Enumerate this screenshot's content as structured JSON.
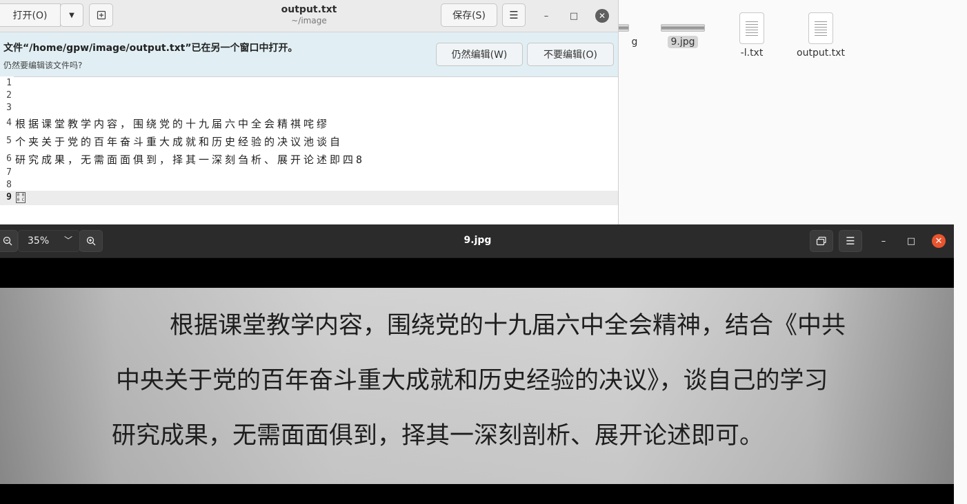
{
  "files": {
    "items": [
      {
        "name": "g",
        "type": "image"
      },
      {
        "name": "9.jpg",
        "type": "image",
        "selected": true
      },
      {
        "name": "-l.txt",
        "type": "text"
      },
      {
        "name": "output.txt",
        "type": "text"
      }
    ]
  },
  "gedit": {
    "open_label": "打开(O)",
    "title": "output.txt",
    "subtitle": "~/image",
    "save_label": "保存(S)",
    "infobar": {
      "title": "文件“/home/gpw/image/output.txt”已在另一个窗口中打开。",
      "subtitle": "仍然要编辑该文件吗?",
      "edit_anyway": "仍然编辑(W)",
      "dont_edit": "不要编辑(O)"
    },
    "lines": [
      {
        "num": "1",
        "text": ""
      },
      {
        "num": "2",
        "text": ""
      },
      {
        "num": "3",
        "text": ""
      },
      {
        "num": "4",
        "text": "根据课堂教学内容，围绕党的十九届六中全会精祺咤缪"
      },
      {
        "num": "5",
        "text": "个夹关于党的百年奋斗重大成就和历史经验的决议池谈自"
      },
      {
        "num": "6",
        "text": "研究成果，无需面面俱到，择其一深刻刍析、展开论述即四8"
      },
      {
        "num": "7",
        "text": ""
      },
      {
        "num": "8",
        "text": ""
      },
      {
        "num": "9",
        "text": "",
        "glyph": "0 0 0 C",
        "current": true
      }
    ]
  },
  "viewer": {
    "zoom": "35%",
    "title": "9.jpg",
    "photo_lines": [
      "根据课堂教学内容，围绕党的十九届六中全会精神，结合《中共",
      "中央关于党的百年奋斗重大成就和历史经验的决议》，谈自己的学习",
      "研究成果，无需面面俱到，择其一深刻剖析、展开论述即可。"
    ]
  }
}
